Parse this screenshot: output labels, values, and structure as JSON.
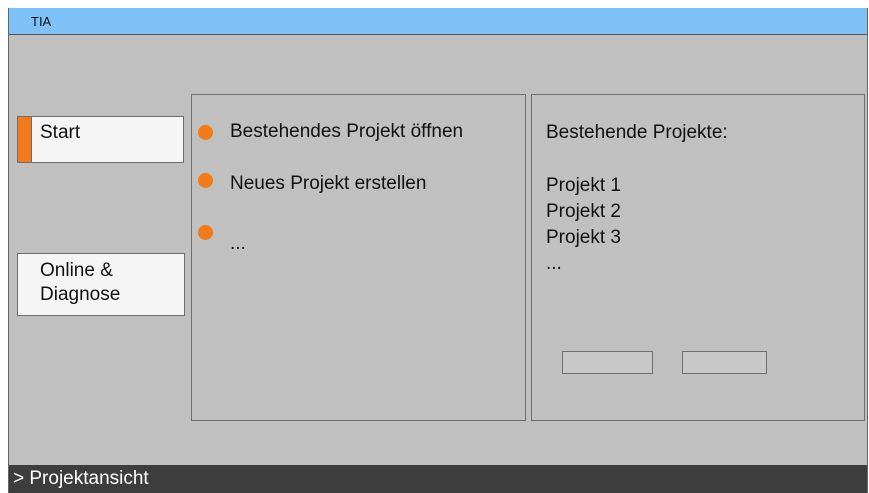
{
  "window": {
    "title": "TIA"
  },
  "nav": {
    "start_label": "Start",
    "online_label": "Online & Diagnose"
  },
  "actions": [
    {
      "label": "Bestehendes Projekt öffnen",
      "icon": "bullet-dot-icon"
    },
    {
      "label": "Neues Projekt erstellen",
      "icon": "bullet-dot-icon"
    },
    {
      "label": "...",
      "icon": "bullet-dot-icon"
    }
  ],
  "projects": {
    "heading": "Bestehende Projekte:",
    "items": [
      "Projekt 1",
      "Projekt 2",
      "Projekt 3",
      "..."
    ]
  },
  "footer": {
    "project_view_label": "> Projektansicht"
  },
  "colors": {
    "titlebar": "#7ec1f7",
    "accent": "#f27a1a",
    "background": "#c0c0c0",
    "statusbar": "#3d3d3d"
  }
}
